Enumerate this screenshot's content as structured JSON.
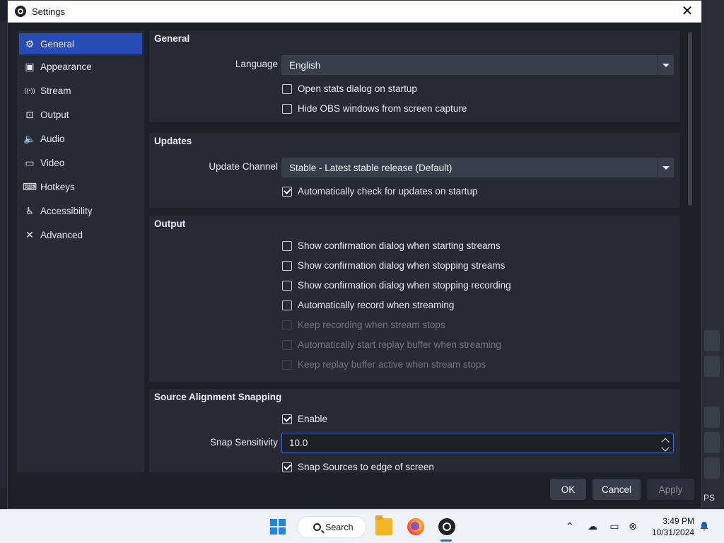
{
  "window": {
    "title": "Settings",
    "close_glyph": "✕"
  },
  "sidebar": {
    "items": [
      {
        "label": "General",
        "icon": "gear-icon",
        "glyph": "⚙",
        "active": true
      },
      {
        "label": "Appearance",
        "icon": "appearance-icon",
        "glyph": "▣"
      },
      {
        "label": "Stream",
        "icon": "stream-icon",
        "glyph": "((•))"
      },
      {
        "label": "Output",
        "icon": "output-icon",
        "glyph": "⊡"
      },
      {
        "label": "Audio",
        "icon": "audio-icon",
        "glyph": "🔈"
      },
      {
        "label": "Video",
        "icon": "video-icon",
        "glyph": "▭"
      },
      {
        "label": "Hotkeys",
        "icon": "keyboard-icon",
        "glyph": "⌨"
      },
      {
        "label": "Accessibility",
        "icon": "accessibility-icon",
        "glyph": "♿"
      },
      {
        "label": "Advanced",
        "icon": "tools-icon",
        "glyph": "✕"
      }
    ]
  },
  "general": {
    "title": "General",
    "language_label": "Language",
    "language_value": "English",
    "open_stats_label": "Open stats dialog on startup",
    "open_stats_checked": false,
    "hide_obs_label": "Hide OBS windows from screen capture",
    "hide_obs_checked": false
  },
  "updates": {
    "title": "Updates",
    "channel_label": "Update Channel",
    "channel_value": "Stable - Latest stable release (Default)",
    "auto_check_label": "Automatically check for updates on startup",
    "auto_check_checked": true
  },
  "output": {
    "title": "Output",
    "options": [
      {
        "label": "Show confirmation dialog when starting streams",
        "checked": false,
        "enabled": true
      },
      {
        "label": "Show confirmation dialog when stopping streams",
        "checked": false,
        "enabled": true
      },
      {
        "label": "Show confirmation dialog when stopping recording",
        "checked": false,
        "enabled": true
      },
      {
        "label": "Automatically record when streaming",
        "checked": false,
        "enabled": true
      },
      {
        "label": "Keep recording when stream stops",
        "checked": false,
        "enabled": false
      },
      {
        "label": "Automatically start replay buffer when streaming",
        "checked": false,
        "enabled": false
      },
      {
        "label": "Keep replay buffer active when stream stops",
        "checked": false,
        "enabled": false
      }
    ]
  },
  "snapping": {
    "title": "Source Alignment Snapping",
    "enable_label": "Enable",
    "enable_checked": true,
    "sensitivity_label": "Snap Sensitivity",
    "sensitivity_value": "10.0",
    "snap_edge_label": "Snap Sources to edge of screen",
    "snap_edge_checked": true
  },
  "buttons": {
    "ok": "OK",
    "cancel": "Cancel",
    "apply": "Apply"
  },
  "background": {
    "right_label": "PS"
  },
  "taskbar": {
    "search_label": "Search",
    "time": "3:49 PM",
    "date": "10/31/2024"
  },
  "colors": {
    "accent": "#284cb8",
    "dialog_bg": "#1e2028",
    "group_bg": "#272a33"
  }
}
